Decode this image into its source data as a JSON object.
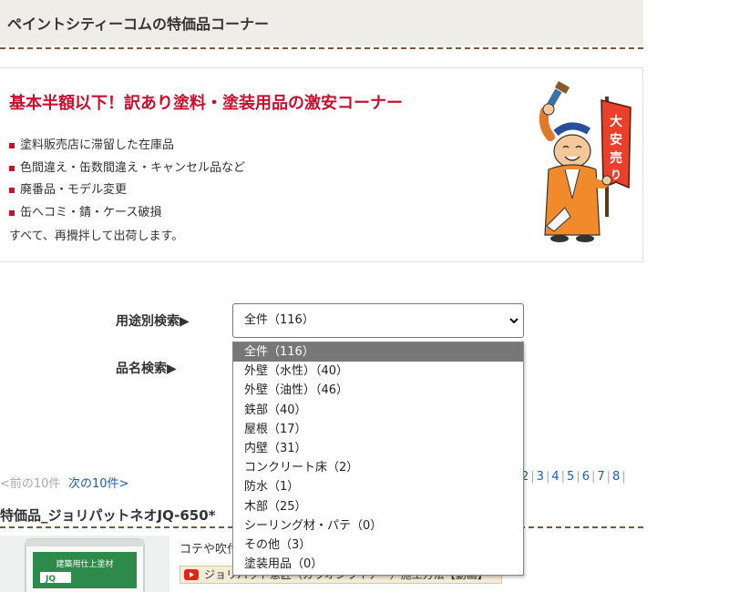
{
  "header": {
    "title": "ペイントシティーコムの特価品コーナー"
  },
  "promo": {
    "heading": "基本半額以下！訳あり塗料・塗装用品の激安コーナー",
    "items": [
      "塗料販売店に滞留した在庫品",
      "色間違え・缶数間違え・キャンセル品など",
      "廃番品・モデル変更",
      "缶へコミ・錆・ケース破損"
    ],
    "footer": "すべて、再攪拌して出荷します。",
    "mascot_sign_text": "大安売り"
  },
  "search": {
    "category_label": "用途別検索▶",
    "name_label": "品名検索▶",
    "selected_value": "全件（116）",
    "options": [
      "全件（116）",
      "外壁（水性）（40）",
      "外壁（油性）（46）",
      "鉄部（40）",
      "屋根（17）",
      "内壁（31）",
      "コンクリート床（2）",
      "防水（1）",
      "木部（25）",
      "シーリング材・パテ（0）",
      "その他（3）",
      "塗装用品（0）"
    ]
  },
  "pagination": {
    "prev": "<前の10件",
    "next": "次の10件>",
    "pages": [
      "2",
      "3",
      "4",
      "5",
      "6",
      "7",
      "8"
    ]
  },
  "product": {
    "title": "特価品_ジョリパットネオJQ-650*",
    "desc": "コテや吹付",
    "video_link": "ジョリパット意匠（ガラオンライナー）施工方法【動画】",
    "can_label": "建築用仕上塗材"
  },
  "colors": {
    "accent_red": "#c8102e",
    "link_blue": "#1a5db6",
    "header_bg": "#efede7",
    "selected_option_bg": "#777777"
  }
}
